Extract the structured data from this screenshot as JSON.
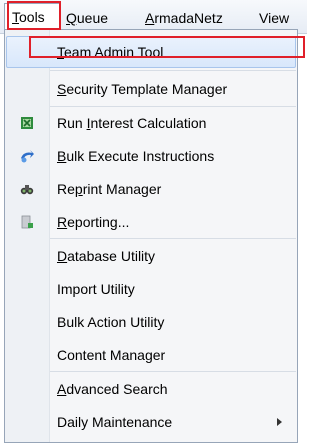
{
  "menubar": {
    "items": [
      {
        "pre": "",
        "u": "T",
        "post": "ools"
      },
      {
        "pre": "",
        "u": "Q",
        "post": "ueue"
      },
      {
        "pre": "",
        "u": "A",
        "post": "rmadaNetz"
      },
      {
        "pre": "",
        "u": "",
        "post": "View"
      }
    ]
  },
  "menu": {
    "items": [
      {
        "pre": "",
        "u": "T",
        "post": "eam Admin Tool",
        "icon": "none"
      },
      {
        "pre": "",
        "u": "S",
        "post": "ecurity Template Manager",
        "icon": "none"
      },
      {
        "pre": "Run ",
        "u": "I",
        "post": "nterest Calculation",
        "icon": "spreadsheet-icon"
      },
      {
        "pre": "",
        "u": "B",
        "post": "ulk Execute Instructions",
        "icon": "execute-icon"
      },
      {
        "pre": "Re",
        "u": "p",
        "post": "rint Manager",
        "icon": "binoculars-icon"
      },
      {
        "pre": "",
        "u": "R",
        "post": "eporting...",
        "icon": "report-icon"
      },
      {
        "pre": "",
        "u": "D",
        "post": "atabase Utility",
        "icon": "none"
      },
      {
        "pre": "Import Utility",
        "u": "",
        "post": "",
        "icon": "none"
      },
      {
        "pre": "Bulk Action Utility",
        "u": "",
        "post": "",
        "icon": "none"
      },
      {
        "pre": "Content Manager",
        "u": "",
        "post": "",
        "icon": "none"
      },
      {
        "pre": "",
        "u": "A",
        "post": "dvanced Search",
        "icon": "none"
      },
      {
        "pre": "Daily Maintenance",
        "u": "",
        "post": "",
        "icon": "none",
        "submenu": true
      }
    ]
  },
  "colors": {
    "highlight": "#e0202a",
    "selection": "#d8e7fb"
  }
}
